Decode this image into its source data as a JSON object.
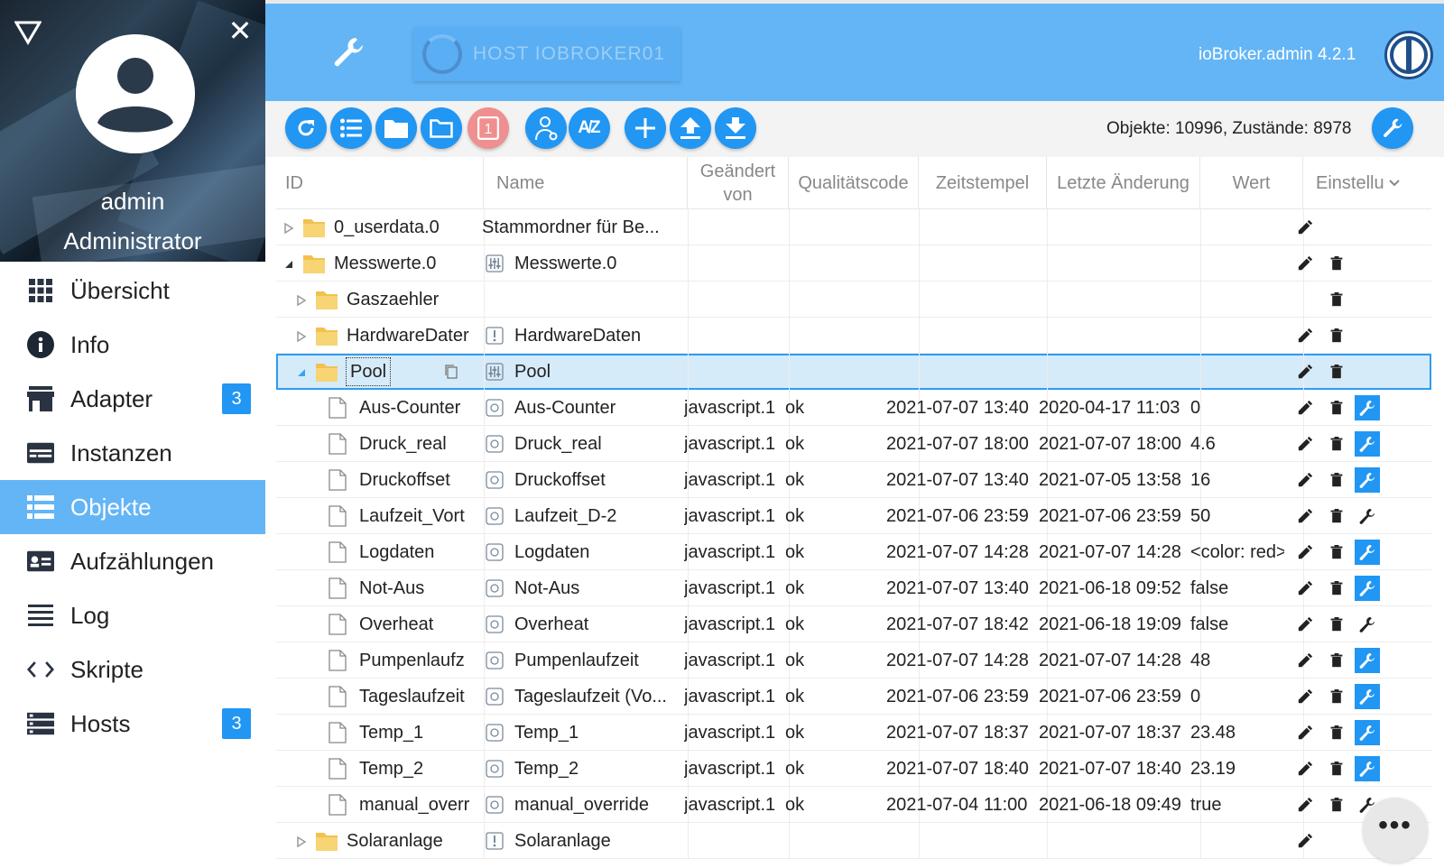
{
  "sidebar": {
    "user": {
      "name": "admin",
      "role": "Administrator"
    },
    "items": [
      {
        "label": "Übersicht",
        "icon": "apps-grid-icon",
        "active": false,
        "badge": ""
      },
      {
        "label": "Info",
        "icon": "info-icon",
        "active": false,
        "badge": ""
      },
      {
        "label": "Adapter",
        "icon": "store-icon",
        "active": false,
        "badge": "3"
      },
      {
        "label": "Instanzen",
        "icon": "instances-icon",
        "active": false,
        "badge": ""
      },
      {
        "label": "Objekte",
        "icon": "objects-list-icon",
        "active": true,
        "badge": ""
      },
      {
        "label": "Aufzählungen",
        "icon": "enums-icon",
        "active": false,
        "badge": ""
      },
      {
        "label": "Log",
        "icon": "log-lines-icon",
        "active": false,
        "badge": ""
      },
      {
        "label": "Skripte",
        "icon": "code-icon",
        "active": false,
        "badge": ""
      },
      {
        "label": "Hosts",
        "icon": "hosts-icon",
        "active": false,
        "badge": "3"
      }
    ]
  },
  "header": {
    "host_label": "HOST IOBROKER01",
    "version": "ioBroker.admin 4.2.1"
  },
  "toolbar": {
    "counts": "Objekte: 10996, Zustände: 8978",
    "badge_number": "1"
  },
  "table": {
    "columns": [
      "ID",
      "Name",
      "Geändert von",
      "Qualitätscode",
      "Zeitstempel",
      "Letzte Änderung",
      "Wert",
      "Einstellu"
    ],
    "rows": [
      {
        "id": "0_userdata.0",
        "name": "Stammordner für Be...",
        "changed_by": "",
        "quality": "",
        "timestamp": "",
        "last_change": "",
        "value": ""
      },
      {
        "id": "Messwerte.0",
        "name": "Messwerte.0",
        "changed_by": "",
        "quality": "",
        "timestamp": "",
        "last_change": "",
        "value": ""
      },
      {
        "id": "Gaszaehler",
        "name": "",
        "changed_by": "",
        "quality": "",
        "timestamp": "",
        "last_change": "",
        "value": ""
      },
      {
        "id": "HardwareDater",
        "name": "HardwareDaten",
        "changed_by": "",
        "quality": "",
        "timestamp": "",
        "last_change": "",
        "value": ""
      },
      {
        "id": "Pool",
        "name": "Pool",
        "changed_by": "",
        "quality": "",
        "timestamp": "",
        "last_change": "",
        "value": ""
      },
      {
        "id": "Aus-Counter",
        "name": "Aus-Counter",
        "changed_by": "javascript.1",
        "quality": "ok",
        "timestamp": "2021-07-07 13:40",
        "last_change": "2020-04-17 11:03",
        "value": "0"
      },
      {
        "id": "Druck_real",
        "name": "Druck_real",
        "changed_by": "javascript.1",
        "quality": "ok",
        "timestamp": "2021-07-07 18:00",
        "last_change": "2021-07-07 18:00",
        "value": "4.6"
      },
      {
        "id": "Druckoffset",
        "name": "Druckoffset",
        "changed_by": "javascript.1",
        "quality": "ok",
        "timestamp": "2021-07-07 13:40",
        "last_change": "2021-07-05 13:58",
        "value": "16"
      },
      {
        "id": "Laufzeit_Vort",
        "name": "Laufzeit_D-2",
        "changed_by": "javascript.1",
        "quality": "ok",
        "timestamp": "2021-07-06 23:59",
        "last_change": "2021-07-06 23:59",
        "value": "50"
      },
      {
        "id": "Logdaten",
        "name": "Logdaten",
        "changed_by": "javascript.1",
        "quality": "ok",
        "timestamp": "2021-07-07 14:28",
        "last_change": "2021-07-07 14:28",
        "value": "<color: red>"
      },
      {
        "id": "Not-Aus",
        "name": "Not-Aus",
        "changed_by": "javascript.1",
        "quality": "ok",
        "timestamp": "2021-07-07 13:40",
        "last_change": "2021-06-18 09:52",
        "value": "false"
      },
      {
        "id": "Overheat",
        "name": "Overheat",
        "changed_by": "javascript.1",
        "quality": "ok",
        "timestamp": "2021-07-07 18:42",
        "last_change": "2021-06-18 19:09",
        "value": "false"
      },
      {
        "id": "Pumpenlaufz",
        "name": "Pumpenlaufzeit",
        "changed_by": "javascript.1",
        "quality": "ok",
        "timestamp": "2021-07-07 14:28",
        "last_change": "2021-07-07 14:28",
        "value": "48"
      },
      {
        "id": "Tageslaufzeit",
        "name": "Tageslaufzeit (Vo...",
        "changed_by": "javascript.1",
        "quality": "ok",
        "timestamp": "2021-07-06 23:59",
        "last_change": "2021-07-06 23:59",
        "value": "0"
      },
      {
        "id": "Temp_1",
        "name": "Temp_1",
        "changed_by": "javascript.1",
        "quality": "ok",
        "timestamp": "2021-07-07 18:37",
        "last_change": "2021-07-07 18:37",
        "value": "23.48"
      },
      {
        "id": "Temp_2",
        "name": "Temp_2",
        "changed_by": "javascript.1",
        "quality": "ok",
        "timestamp": "2021-07-07 18:40",
        "last_change": "2021-07-07 18:40",
        "value": "23.19"
      },
      {
        "id": "manual_overr",
        "name": "manual_override",
        "changed_by": "javascript.1",
        "quality": "ok",
        "timestamp": "2021-07-04 11:00",
        "last_change": "2021-06-18 09:49",
        "value": "true"
      },
      {
        "id": "Solaranlage",
        "name": "Solaranlage",
        "changed_by": "",
        "quality": "",
        "timestamp": "",
        "last_change": "",
        "value": ""
      }
    ]
  },
  "colors": {
    "accent": "#2196f3",
    "header": "#64b5f6",
    "selected_row": "#d6ebf9"
  }
}
